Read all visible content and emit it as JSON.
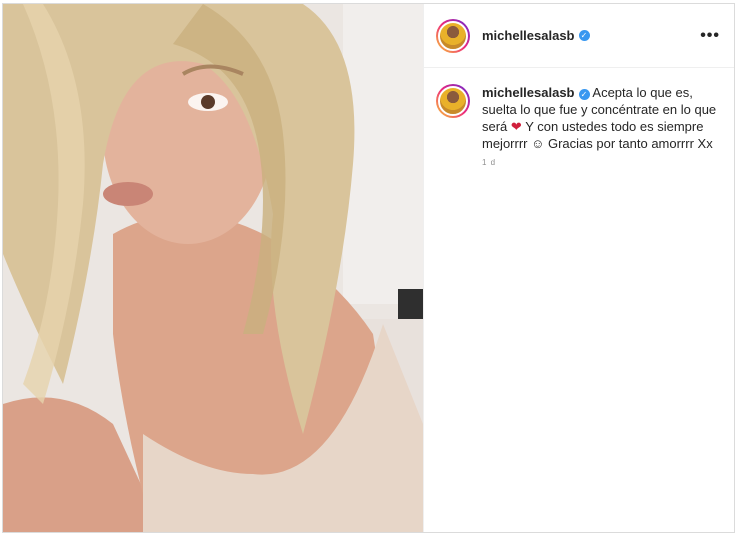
{
  "post": {
    "username": "michellesalasb",
    "caption": {
      "part1": "Acepta lo que es, suelta lo que fue y concéntrate en lo que será",
      "heart": "❤",
      "part2": "Y con ustedes todo es siempre mejorrrr ☺ Gracias por tanto amorrrr Xx"
    },
    "timestamp": "1 d",
    "more_icon": "more-horizontal-icon",
    "verified_icon": "verified-badge-icon"
  },
  "colors": {
    "username": "#262626",
    "verified": "#3897f0",
    "border": "#dbdbdb",
    "heart": "#d01f3c",
    "timestamp": "#8e8e8e"
  }
}
